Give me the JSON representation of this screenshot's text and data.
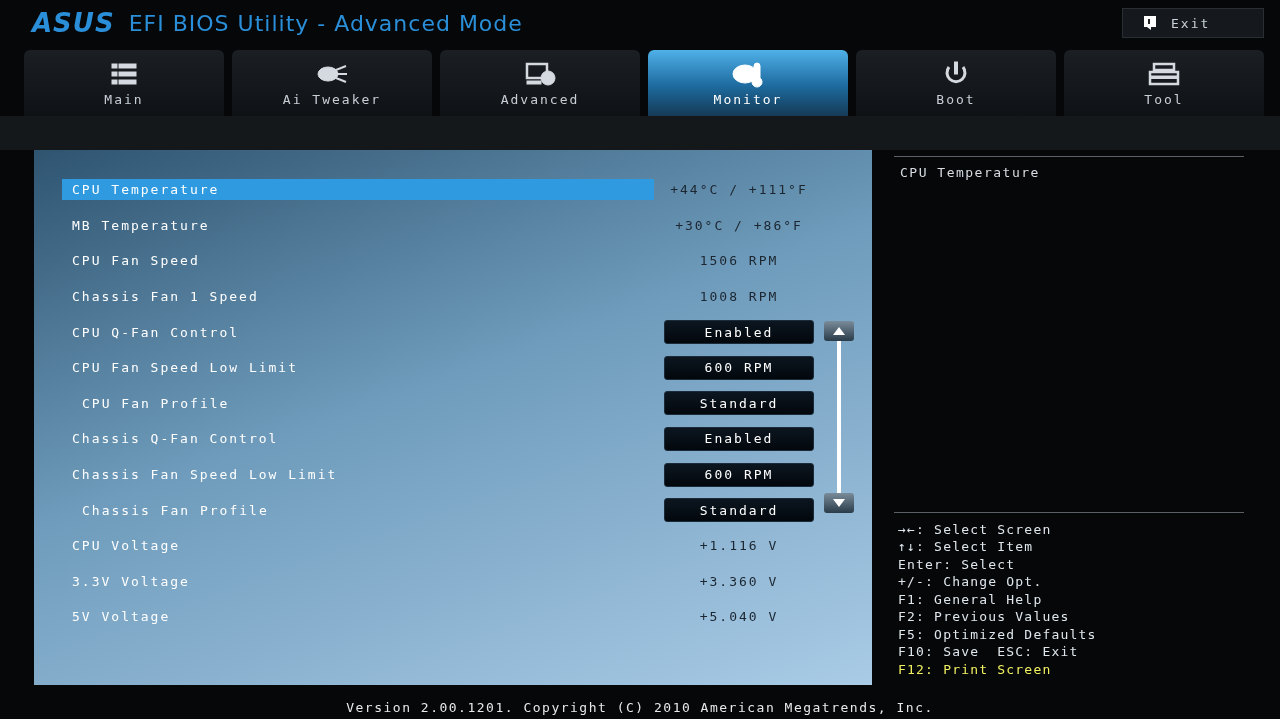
{
  "header": {
    "logo": "ASUS",
    "title": "EFI BIOS Utility - Advanced Mode",
    "exit_button": "Exit"
  },
  "tabs": [
    {
      "label": "Main",
      "selected": false
    },
    {
      "label": "Ai Tweaker",
      "selected": false
    },
    {
      "label": "Advanced",
      "selected": false
    },
    {
      "label": "Monitor",
      "selected": true
    },
    {
      "label": "Boot",
      "selected": false
    },
    {
      "label": "Tool",
      "selected": false
    }
  ],
  "settings": [
    {
      "kind": "reading",
      "label": "CPU Temperature",
      "value": "+44°C / +111°F",
      "selected": true
    },
    {
      "kind": "reading",
      "label": "MB Temperature",
      "value": "+30°C / +86°F",
      "selected": false
    },
    {
      "kind": "reading",
      "label": "CPU Fan Speed",
      "value": "1506 RPM",
      "selected": false
    },
    {
      "kind": "reading",
      "label": "Chassis Fan 1 Speed",
      "value": "1008 RPM",
      "selected": false
    },
    {
      "kind": "option",
      "label": "CPU Q-Fan Control",
      "value": "Enabled",
      "selected": false
    },
    {
      "kind": "option",
      "label": "CPU Fan Speed Low Limit",
      "value": "600 RPM",
      "selected": false,
      "children": [
        {
          "kind": "option",
          "label": "CPU Fan Profile",
          "value": "Standard",
          "selected": false
        }
      ]
    },
    {
      "kind": "option",
      "label": "Chassis Q-Fan Control",
      "value": "Enabled",
      "selected": false
    },
    {
      "kind": "option",
      "label": "Chassis Fan Speed Low Limit",
      "value": "600 RPM",
      "selected": false,
      "children": [
        {
          "kind": "option",
          "label": "Chassis Fan Profile",
          "value": "Standard",
          "selected": false
        }
      ]
    },
    {
      "kind": "reading",
      "label": "CPU Voltage",
      "value": "+1.116 V",
      "selected": false
    },
    {
      "kind": "reading",
      "label": "3.3V Voltage",
      "value": "+3.360 V",
      "selected": false
    },
    {
      "kind": "reading",
      "label": "5V Voltage",
      "value": "+5.040 V",
      "selected": false
    }
  ],
  "help_text": "CPU Temperature",
  "key_hints": [
    {
      "text": "→←: Select Screen",
      "highlighted": false
    },
    {
      "text": "↑↓: Select Item",
      "highlighted": false
    },
    {
      "text": "Enter: Select",
      "highlighted": false
    },
    {
      "text": "+/-: Change Opt.",
      "highlighted": false
    },
    {
      "text": "F1: General Help",
      "highlighted": false
    },
    {
      "text": "F2: Previous Values",
      "highlighted": false
    },
    {
      "text": "F5: Optimized Defaults",
      "highlighted": false
    },
    {
      "text": "F10: Save  ESC: Exit",
      "highlighted": false
    },
    {
      "text": "F12: Print Screen",
      "highlighted": true
    }
  ],
  "footer": "Version 2.00.1201. Copyright (C) 2010 American Megatrends, Inc."
}
